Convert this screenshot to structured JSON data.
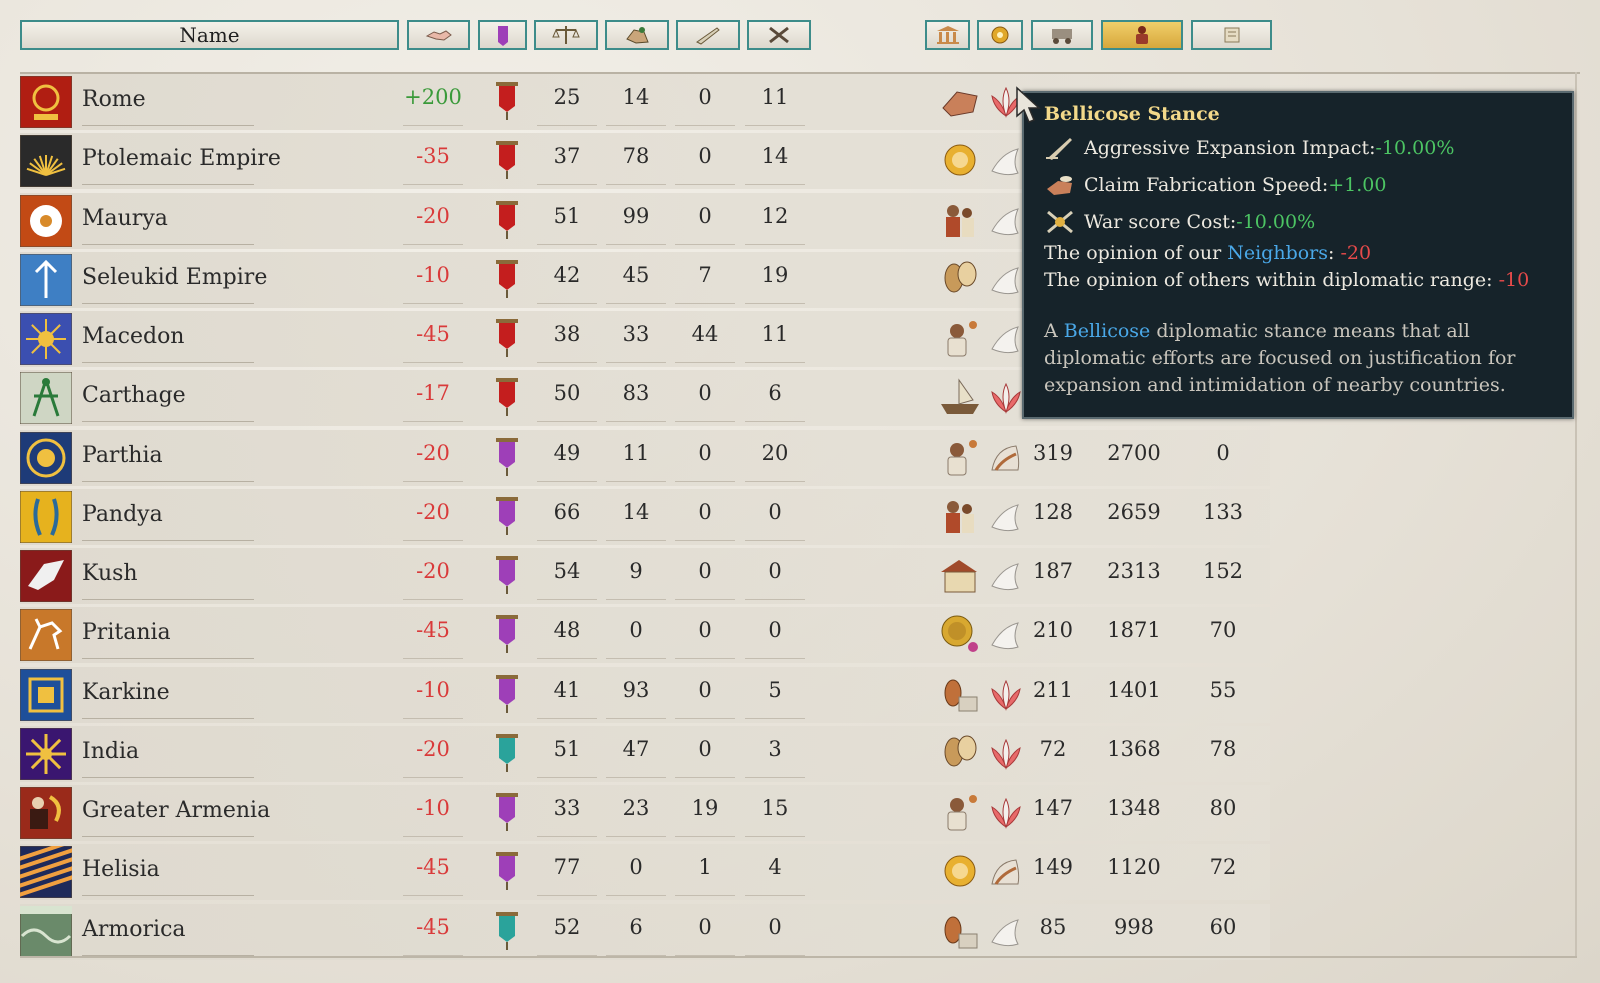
{
  "header": {
    "name_label": "Name",
    "column_icons": [
      "handshake-icon",
      "banner-icon",
      "scales-icon",
      "claim-icon",
      "dagger-icon",
      "war-icon"
    ],
    "right_icons": [
      "temple-icon",
      "laurel-icon",
      "wagon-icon",
      "soldiers-icon",
      "scroll-icon"
    ]
  },
  "rows": [
    {
      "name": "Rome",
      "opinion": "+200",
      "banner": "red",
      "c1": "25",
      "c2": "14",
      "c3": "0",
      "c4": "11",
      "stance_icon": "fabricate-icon",
      "dove": "lotus",
      "d1": "",
      "d2": "",
      "d3": ""
    },
    {
      "name": "Ptolemaic Empire",
      "opinion": "-35",
      "banner": "red",
      "c1": "37",
      "c2": "78",
      "c3": "0",
      "c4": "14",
      "stance_icon": "sun-icon",
      "dove": "dove",
      "d1": "",
      "d2": "",
      "d3": ""
    },
    {
      "name": "Maurya",
      "opinion": "-20",
      "banner": "red",
      "c1": "51",
      "c2": "99",
      "c3": "0",
      "c4": "12",
      "stance_icon": "family-icon",
      "dove": "dove",
      "d1": "",
      "d2": "",
      "d3": ""
    },
    {
      "name": "Seleukid Empire",
      "opinion": "-10",
      "banner": "red",
      "c1": "42",
      "c2": "45",
      "c3": "7",
      "c4": "19",
      "stance_icon": "masks-icon",
      "dove": "dove",
      "d1": "",
      "d2": "",
      "d3": ""
    },
    {
      "name": "Macedon",
      "opinion": "-45",
      "banner": "red",
      "c1": "38",
      "c2": "33",
      "c3": "44",
      "c4": "11",
      "stance_icon": "merchant-icon",
      "dove": "dove",
      "d1": "",
      "d2": "",
      "d3": ""
    },
    {
      "name": "Carthage",
      "opinion": "-17",
      "banner": "red",
      "c1": "50",
      "c2": "83",
      "c3": "0",
      "c4": "6",
      "stance_icon": "ship-icon",
      "dove": "lotus",
      "d1": "",
      "d2": "",
      "d3": ""
    },
    {
      "name": "Parthia",
      "opinion": "-20",
      "banner": "purple",
      "c1": "49",
      "c2": "11",
      "c3": "0",
      "c4": "20",
      "stance_icon": "merchant-icon",
      "dove": "shell",
      "d1": "319",
      "d2": "2700",
      "d3": "0"
    },
    {
      "name": "Pandya",
      "opinion": "-20",
      "banner": "purple",
      "c1": "66",
      "c2": "14",
      "c3": "0",
      "c4": "0",
      "stance_icon": "family-icon",
      "dove": "dove",
      "d1": "128",
      "d2": "2659",
      "d3": "133"
    },
    {
      "name": "Kush",
      "opinion": "-20",
      "banner": "purple",
      "c1": "54",
      "c2": "9",
      "c3": "0",
      "c4": "0",
      "stance_icon": "house-icon",
      "dove": "dove",
      "d1": "187",
      "d2": "2313",
      "d3": "152"
    },
    {
      "name": "Pritania",
      "opinion": "-45",
      "banner": "purple",
      "c1": "48",
      "c2": "0",
      "c3": "0",
      "c4": "0",
      "stance_icon": "coin-icon",
      "dove": "dove",
      "d1": "210",
      "d2": "1871",
      "d3": "70"
    },
    {
      "name": "Karkine",
      "opinion": "-10",
      "banner": "purple",
      "c1": "41",
      "c2": "93",
      "c3": "0",
      "c4": "5",
      "stance_icon": "amphora-icon",
      "dove": "lotus",
      "d1": "211",
      "d2": "1401",
      "d3": "55"
    },
    {
      "name": "India",
      "opinion": "-20",
      "banner": "teal",
      "c1": "51",
      "c2": "47",
      "c3": "0",
      "c4": "3",
      "stance_icon": "masks-icon",
      "dove": "lotus",
      "d1": "72",
      "d2": "1368",
      "d3": "78"
    },
    {
      "name": "Greater Armenia",
      "opinion": "-10",
      "banner": "purple",
      "c1": "33",
      "c2": "23",
      "c3": "19",
      "c4": "15",
      "stance_icon": "merchant-icon",
      "dove": "lotus",
      "d1": "147",
      "d2": "1348",
      "d3": "80"
    },
    {
      "name": "Helisia",
      "opinion": "-45",
      "banner": "purple",
      "c1": "77",
      "c2": "0",
      "c3": "1",
      "c4": "4",
      "stance_icon": "sun-icon",
      "dove": "shell",
      "d1": "149",
      "d2": "1120",
      "d3": "72"
    },
    {
      "name": "Armorica",
      "opinion": "-45",
      "banner": "teal",
      "c1": "52",
      "c2": "6",
      "c3": "0",
      "c4": "0",
      "stance_icon": "amphora-icon",
      "dove": "dove",
      "d1": "85",
      "d2": "998",
      "d3": "60"
    }
  ],
  "tooltip": {
    "title": "Bellicose Stance",
    "modifiers": [
      {
        "label": "Aggressive Expansion Impact: ",
        "value": "-10.00%",
        "icon": "quill-icon"
      },
      {
        "label": "Claim Fabrication Speed: ",
        "value": "+1.00",
        "icon": "fabricate-icon"
      },
      {
        "label": "War score Cost: ",
        "value": "-10.00%",
        "icon": "crossed-swords-icon"
      }
    ],
    "neighbors_pre": "The opinion of our ",
    "neighbors_link": "Neighbors",
    "neighbors_sep": ": ",
    "neighbors_value": "-20",
    "others_text": "The opinion of others within diplomatic range: ",
    "others_value": "-10",
    "desc_pre": "A ",
    "desc_link": "Bellicose",
    "desc_post": " diplomatic stance means that all diplomatic efforts are focused on justification for expansion and intimidation of nearby countries."
  },
  "colors": {
    "flags": [
      "#b01e12",
      "#2a2a2a",
      "#c24a15",
      "#3e7fc4",
      "#3b4fb0",
      "#cfd6c4",
      "#1e3b78",
      "#e6b21e",
      "#8a1a1a",
      "#c8782a",
      "#1e4f9a",
      "#3a1670",
      "#9a2a1a",
      "#1e2a5a",
      "#6a8a6a"
    ],
    "flag_symbol": [
      "#f0c040",
      "#f0c040",
      "#ffffff",
      "#ffffff",
      "#f0c040",
      "#2a7a3a",
      "#f0c040",
      "#2a6a9a",
      "#f0f0f0",
      "#ffffff",
      "#f0c040",
      "#f0c040",
      "#f0c040",
      "#f0a040",
      "#d8e4d0"
    ],
    "banner_red": "#c41e1e",
    "banner_purple": "#9e3fb8",
    "banner_teal": "#2aa39b",
    "opinion_negative": "#d93a3a",
    "opinion_positive": "#3a9a3a",
    "header_border": "#3d8c8a",
    "header_active": "#e0b64a"
  }
}
